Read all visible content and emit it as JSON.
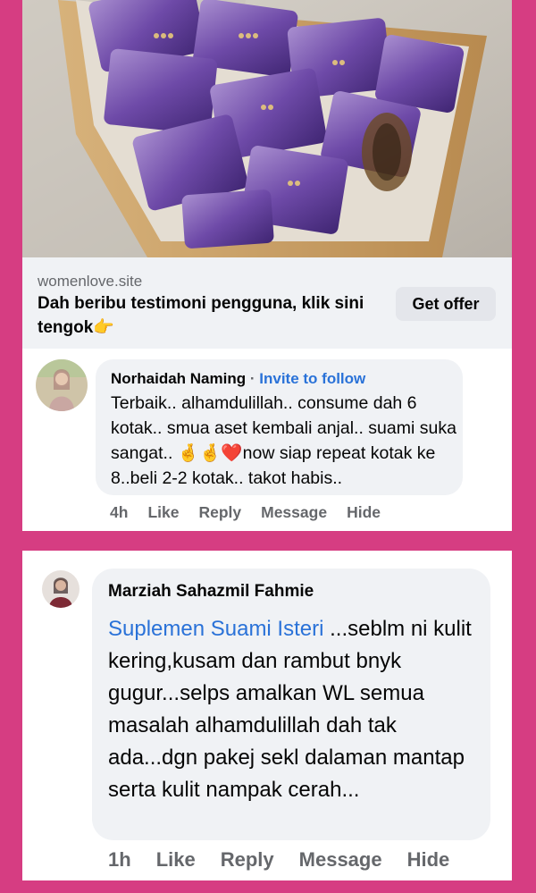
{
  "ad": {
    "domain": "womenlove.site",
    "headline": "Dah beribu testimoni pengguna, klik sini tengok",
    "headline_emoji": "👉",
    "cta_label": "Get offer"
  },
  "comment1": {
    "author": "Norhaidah Naming",
    "separator": "·",
    "invite_label": "Invite to follow",
    "text": "Terbaik.. alhamdulillah.. consume dah 6 kotak.. smua aset kembali anjal.. suami suka sangat.. 🤞🤞❤️now siap repeat kotak ke 8..beli 2-2 kotak.. takot habis..",
    "time": "4h",
    "like": "Like",
    "reply": "Reply",
    "message": "Message",
    "hide": "Hide"
  },
  "comment2": {
    "author": "Marziah Sahazmil Fahmie",
    "link_text": "Suplemen Suami Isteri",
    "text": " ...seblm ni kulit kering,kusam dan rambut bnyk gugur...selps amalkan WL semua masalah alhamdulillah dah tak ada...dgn pakej sekl dalaman mantap serta kulit nampak cerah...",
    "time": "1h",
    "like": "Like",
    "reply": "Reply",
    "message": "Message",
    "hide": "Hide"
  },
  "colors": {
    "background": "#d63d82",
    "link": "#2a72d8",
    "muted": "#65676b"
  }
}
